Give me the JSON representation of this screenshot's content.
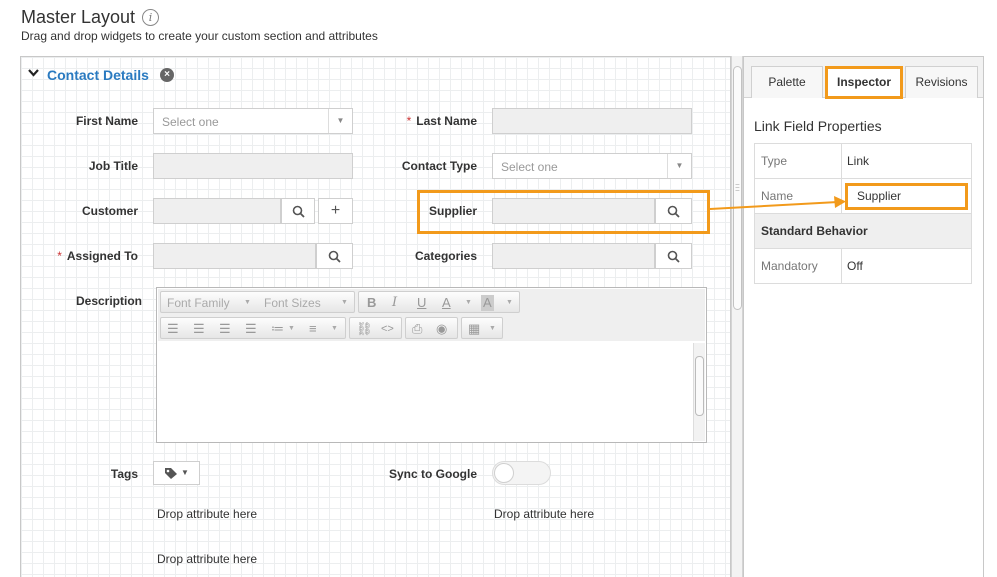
{
  "header": {
    "title": "Master Layout",
    "info_icon": "i",
    "subtitle": "Drag and drop widgets to create your custom section and attributes"
  },
  "section": {
    "title": "Contact Details",
    "remove_icon": "×",
    "collapse_icon": "chevron-down-icon"
  },
  "fields": {
    "first_name": {
      "label": "First Name",
      "placeholder": "Select one"
    },
    "last_name": {
      "label": "Last Name",
      "required": "*"
    },
    "job_title": {
      "label": "Job Title"
    },
    "contact_type": {
      "label": "Contact Type",
      "placeholder": "Select one"
    },
    "customer": {
      "label": "Customer",
      "add_icon": "+"
    },
    "supplier": {
      "label": "Supplier"
    },
    "assigned_to": {
      "label": "Assigned To",
      "required": "*"
    },
    "categories": {
      "label": "Categories"
    },
    "description": {
      "label": "Description"
    },
    "tags": {
      "label": "Tags"
    },
    "sync_google": {
      "label": "Sync to Google",
      "value": "off"
    }
  },
  "editor": {
    "font_family": "Font Family",
    "font_sizes": "Font Sizes",
    "bold": "B",
    "italic": "I",
    "underline": "U",
    "font_color": "A",
    "bg_color": "A"
  },
  "drop_zones": [
    "Drop attribute here",
    "Drop attribute here",
    "Drop attribute here"
  ],
  "panel": {
    "tabs": [
      {
        "label": "Palette",
        "active": false
      },
      {
        "label": "Inspector",
        "active": true
      },
      {
        "label": "Revisions",
        "active": false
      }
    ],
    "heading": "Link Field Properties",
    "properties": [
      {
        "key": "Type",
        "value": "Link"
      },
      {
        "key": "Name",
        "value": "Supplier"
      }
    ],
    "standard_behavior": "Standard Behavior",
    "behavior_properties": [
      {
        "key": "Mandatory",
        "value": "Off"
      }
    ]
  },
  "colors": {
    "accent": "#2a7ac0",
    "highlight": "#f29a1b",
    "required": "#cc3333"
  }
}
